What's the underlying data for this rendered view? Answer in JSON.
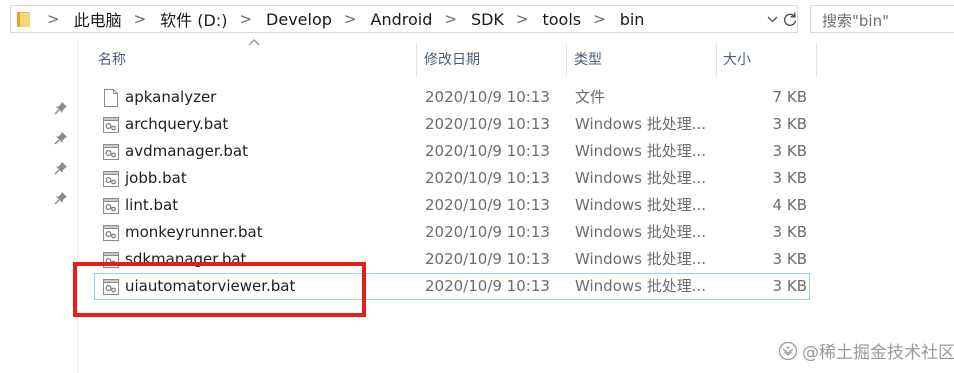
{
  "address_bar": {
    "folder_icon": "folder-icon",
    "breadcrumbs": [
      "此电脑",
      "软件 (D:)",
      "Develop",
      "Android",
      "SDK",
      "tools",
      "bin"
    ],
    "separator": ">",
    "dropdown_icon": "chevron-down-icon",
    "refresh_icon": "refresh-icon"
  },
  "search": {
    "placeholder": "搜索\"bin\""
  },
  "columns": {
    "name": "名称",
    "date": "修改日期",
    "type": "类型",
    "size": "大小",
    "sort_icon": "sort-ascending-icon"
  },
  "files": [
    {
      "name": "apkanalyzer",
      "date": "2020/10/9 10:13",
      "type": "文件",
      "size": "7 KB",
      "icon": "file-icon"
    },
    {
      "name": "archquery.bat",
      "date": "2020/10/9 10:13",
      "type": "Windows 批处理...",
      "size": "3 KB",
      "icon": "batch-file-icon"
    },
    {
      "name": "avdmanager.bat",
      "date": "2020/10/9 10:13",
      "type": "Windows 批处理...",
      "size": "3 KB",
      "icon": "batch-file-icon"
    },
    {
      "name": "jobb.bat",
      "date": "2020/10/9 10:13",
      "type": "Windows 批处理...",
      "size": "3 KB",
      "icon": "batch-file-icon"
    },
    {
      "name": "lint.bat",
      "date": "2020/10/9 10:13",
      "type": "Windows 批处理...",
      "size": "4 KB",
      "icon": "batch-file-icon"
    },
    {
      "name": "monkeyrunner.bat",
      "date": "2020/10/9 10:13",
      "type": "Windows 批处理...",
      "size": "3 KB",
      "icon": "batch-file-icon"
    },
    {
      "name": "sdkmanager.bat",
      "date": "2020/10/9 10:13",
      "type": "Windows 批处理...",
      "size": "3 KB",
      "icon": "batch-file-icon"
    },
    {
      "name": "uiautomatorviewer.bat",
      "date": "2020/10/9 10:13",
      "type": "Windows 批处理...",
      "size": "3 KB",
      "icon": "batch-file-icon"
    }
  ],
  "selected_file": "uiautomatorviewer.bat",
  "colors": {
    "highlight_border": "#e0201c",
    "selection_border": "#99d1ff",
    "header_text": "#4c607a"
  },
  "watermark": {
    "text": "@稀土掘金技术社区",
    "icon": "juejin-logo-icon"
  }
}
